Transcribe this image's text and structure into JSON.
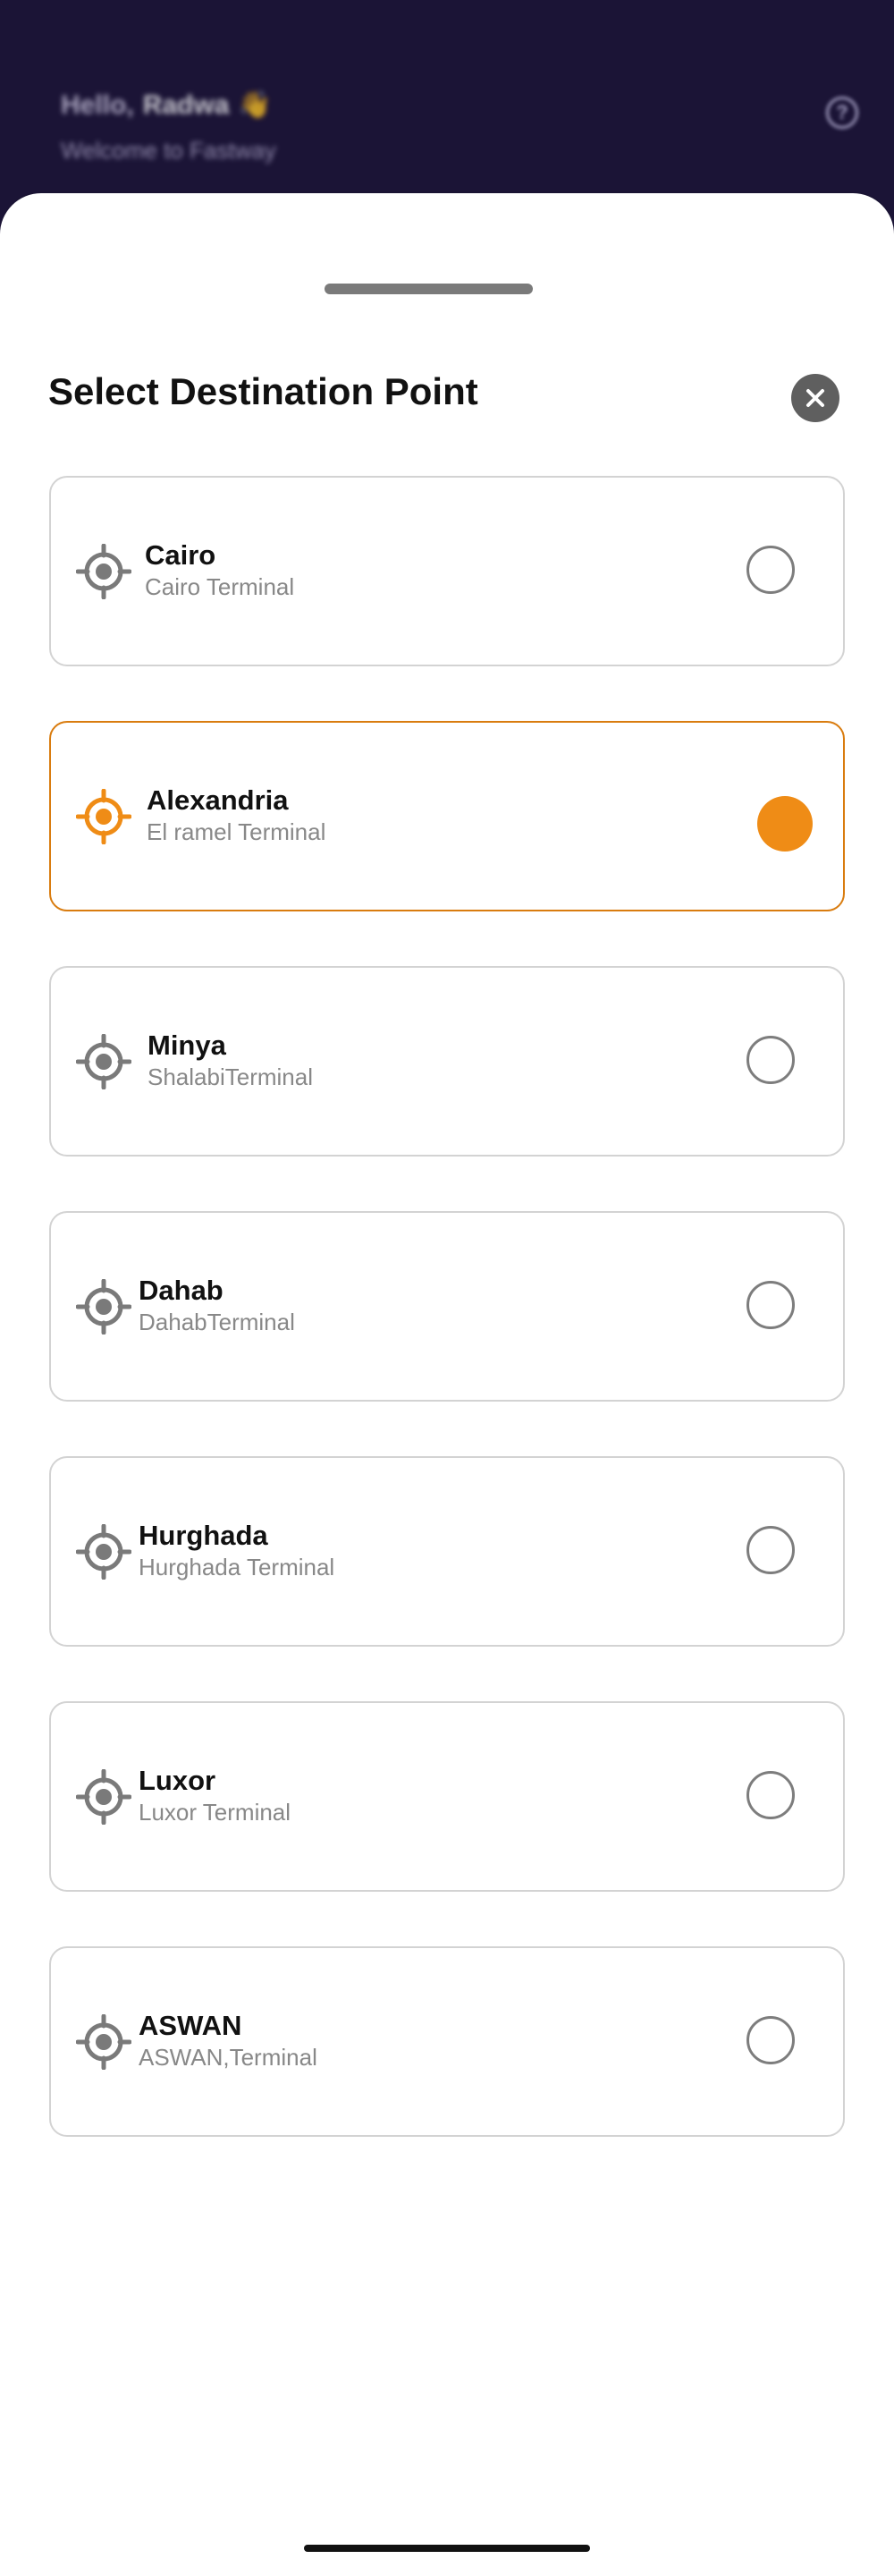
{
  "background": {
    "greeting_prefix": "Hello,",
    "greeting_name": "Radwa",
    "greeting_emoji": "👋",
    "subtitle": "Welcome to Fastway"
  },
  "sheet": {
    "title": "Select Destination Point",
    "close_icon": "close-icon",
    "options": [
      {
        "city": "Cairo",
        "terminal": "Cairo Terminal",
        "selected": false
      },
      {
        "city": "Alexandria",
        "terminal": "El ramel Terminal",
        "selected": true
      },
      {
        "city": "Minya",
        "terminal": "ShalabiTerminal",
        "selected": false
      },
      {
        "city": "Dahab",
        "terminal": "DahabTerminal",
        "selected": false
      },
      {
        "city": "Hurghada",
        "terminal": "Hurghada Terminal",
        "selected": false
      },
      {
        "city": "Luxor",
        "terminal": "Luxor Terminal",
        "selected": false
      },
      {
        "city": "ASWAN",
        "terminal": "ASWAN,Terminal",
        "selected": false
      }
    ]
  },
  "colors": {
    "accent": "#EF8C16",
    "selected_border": "#D97C0F",
    "header_bg": "#1B1436",
    "icon_gray": "#7A7A7A"
  }
}
